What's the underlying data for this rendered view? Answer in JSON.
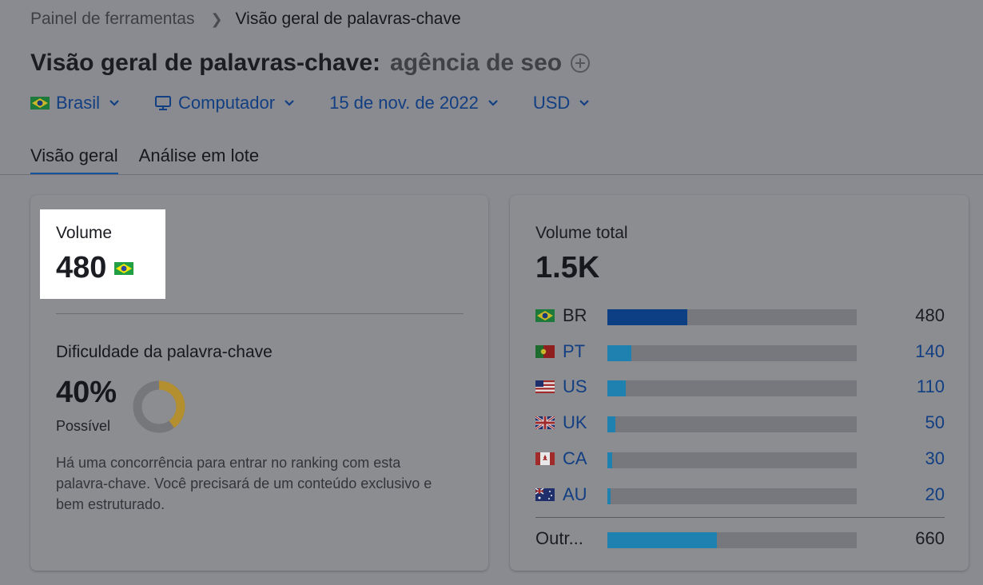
{
  "breadcrumb": {
    "home": "Painel de ferramentas",
    "current": "Visão geral de palavras-chave"
  },
  "header": {
    "title": "Visão geral de palavras-chave:",
    "keyword": "agência de seo"
  },
  "filters": {
    "country": "Brasil",
    "device": "Computador",
    "date": "15 de nov. de 2022",
    "currency": "USD"
  },
  "tabs": [
    {
      "label": "Visão geral"
    },
    {
      "label": "Análise em lote"
    }
  ],
  "volume": {
    "label": "Volume",
    "value": "480"
  },
  "difficulty": {
    "label": "Dificuldade da palavra-chave",
    "value": "40%",
    "percent": 40,
    "level": "Possível",
    "description": "Há uma concorrência para entrar no ranking com esta palavra-chave. Você precisará de um conteúdo exclusivo e bem estruturado."
  },
  "total_volume": {
    "label": "Volume total",
    "value": "1.5K",
    "rows": [
      {
        "code": "BR",
        "value": "480",
        "share": 0.32
      },
      {
        "code": "PT",
        "value": "140",
        "share": 0.095
      },
      {
        "code": "US",
        "value": "110",
        "share": 0.075
      },
      {
        "code": "UK",
        "value": "50",
        "share": 0.033
      },
      {
        "code": "CA",
        "value": "30",
        "share": 0.02
      },
      {
        "code": "AU",
        "value": "20",
        "share": 0.013
      },
      {
        "code": "Outr...",
        "value": "660",
        "share": 0.44
      }
    ]
  },
  "colors": {
    "link": "#123e82",
    "bar_dark": "#0c3f84",
    "bar_light": "#1e81b0",
    "donut": "#b38f2f"
  }
}
